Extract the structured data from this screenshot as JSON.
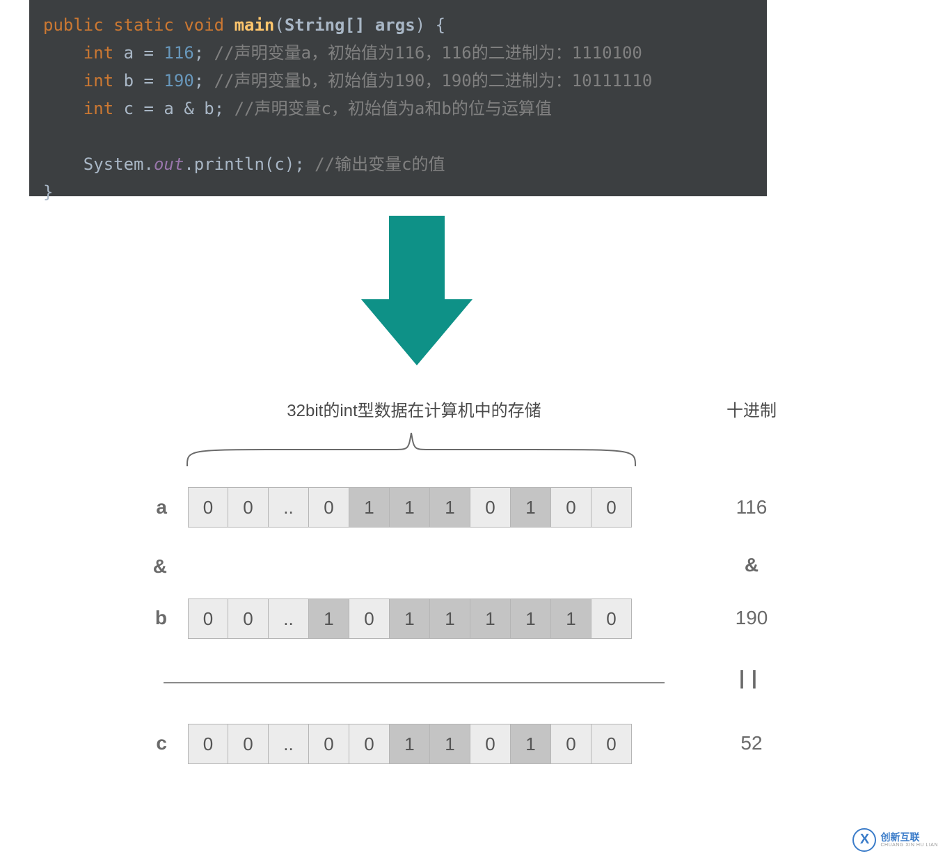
{
  "code": {
    "signature": {
      "kw_public": "public",
      "kw_static": "static",
      "kw_void": "void",
      "fn_main": "main",
      "param_type": "String[]",
      "param_name": "args",
      "open_brace": "{",
      "close_brace": "}"
    },
    "lines": [
      {
        "type_kw": "int",
        "name": "a",
        "eq": " = ",
        "val": "116",
        "semi": ";",
        "comment": " //声明变量a，初始值为116，116的二进制为：1110100"
      },
      {
        "type_kw": "int",
        "name": "b",
        "eq": " = ",
        "val": "190",
        "semi": ";",
        "comment": " //声明变量b，初始值为190，190的二进制为：10111110"
      },
      {
        "type_kw": "int",
        "name": "c",
        "eq": " = ",
        "expr_a": "a",
        "expr_op": " & ",
        "expr_b": "b",
        "semi": ";",
        "comment": " //声明变量c，初始值为a和b的位与运算值"
      }
    ],
    "out_line": {
      "cls": "System",
      "dot1": ".",
      "field": "out",
      "dot2": ".",
      "method": "println",
      "open": "(",
      "arg": "c",
      "close": ")",
      "semi": ";",
      "comment": " //输出变量c的值"
    }
  },
  "diagram": {
    "title": "32bit的int型数据在计算机中的存储",
    "dec_title": "十进制",
    "rows": {
      "a": {
        "label": "a",
        "bits": [
          "0",
          "0",
          "..",
          "0",
          "1",
          "1",
          "1",
          "0",
          "1",
          "0",
          "0"
        ],
        "dec": "116"
      },
      "op": {
        "label": "&",
        "dec": "&"
      },
      "b": {
        "label": "b",
        "bits": [
          "0",
          "0",
          "..",
          "1",
          "0",
          "1",
          "1",
          "1",
          "1",
          "1",
          "0"
        ],
        "dec": "190"
      },
      "eq": {
        "dec": "||"
      },
      "c": {
        "label": "c",
        "bits": [
          "0",
          "0",
          "..",
          "0",
          "0",
          "1",
          "1",
          "0",
          "1",
          "0",
          "0"
        ],
        "dec": "52"
      }
    }
  },
  "watermark": {
    "icon": "X",
    "main": "创新互联",
    "sub": "CHUANG XIN HU LIAN"
  }
}
